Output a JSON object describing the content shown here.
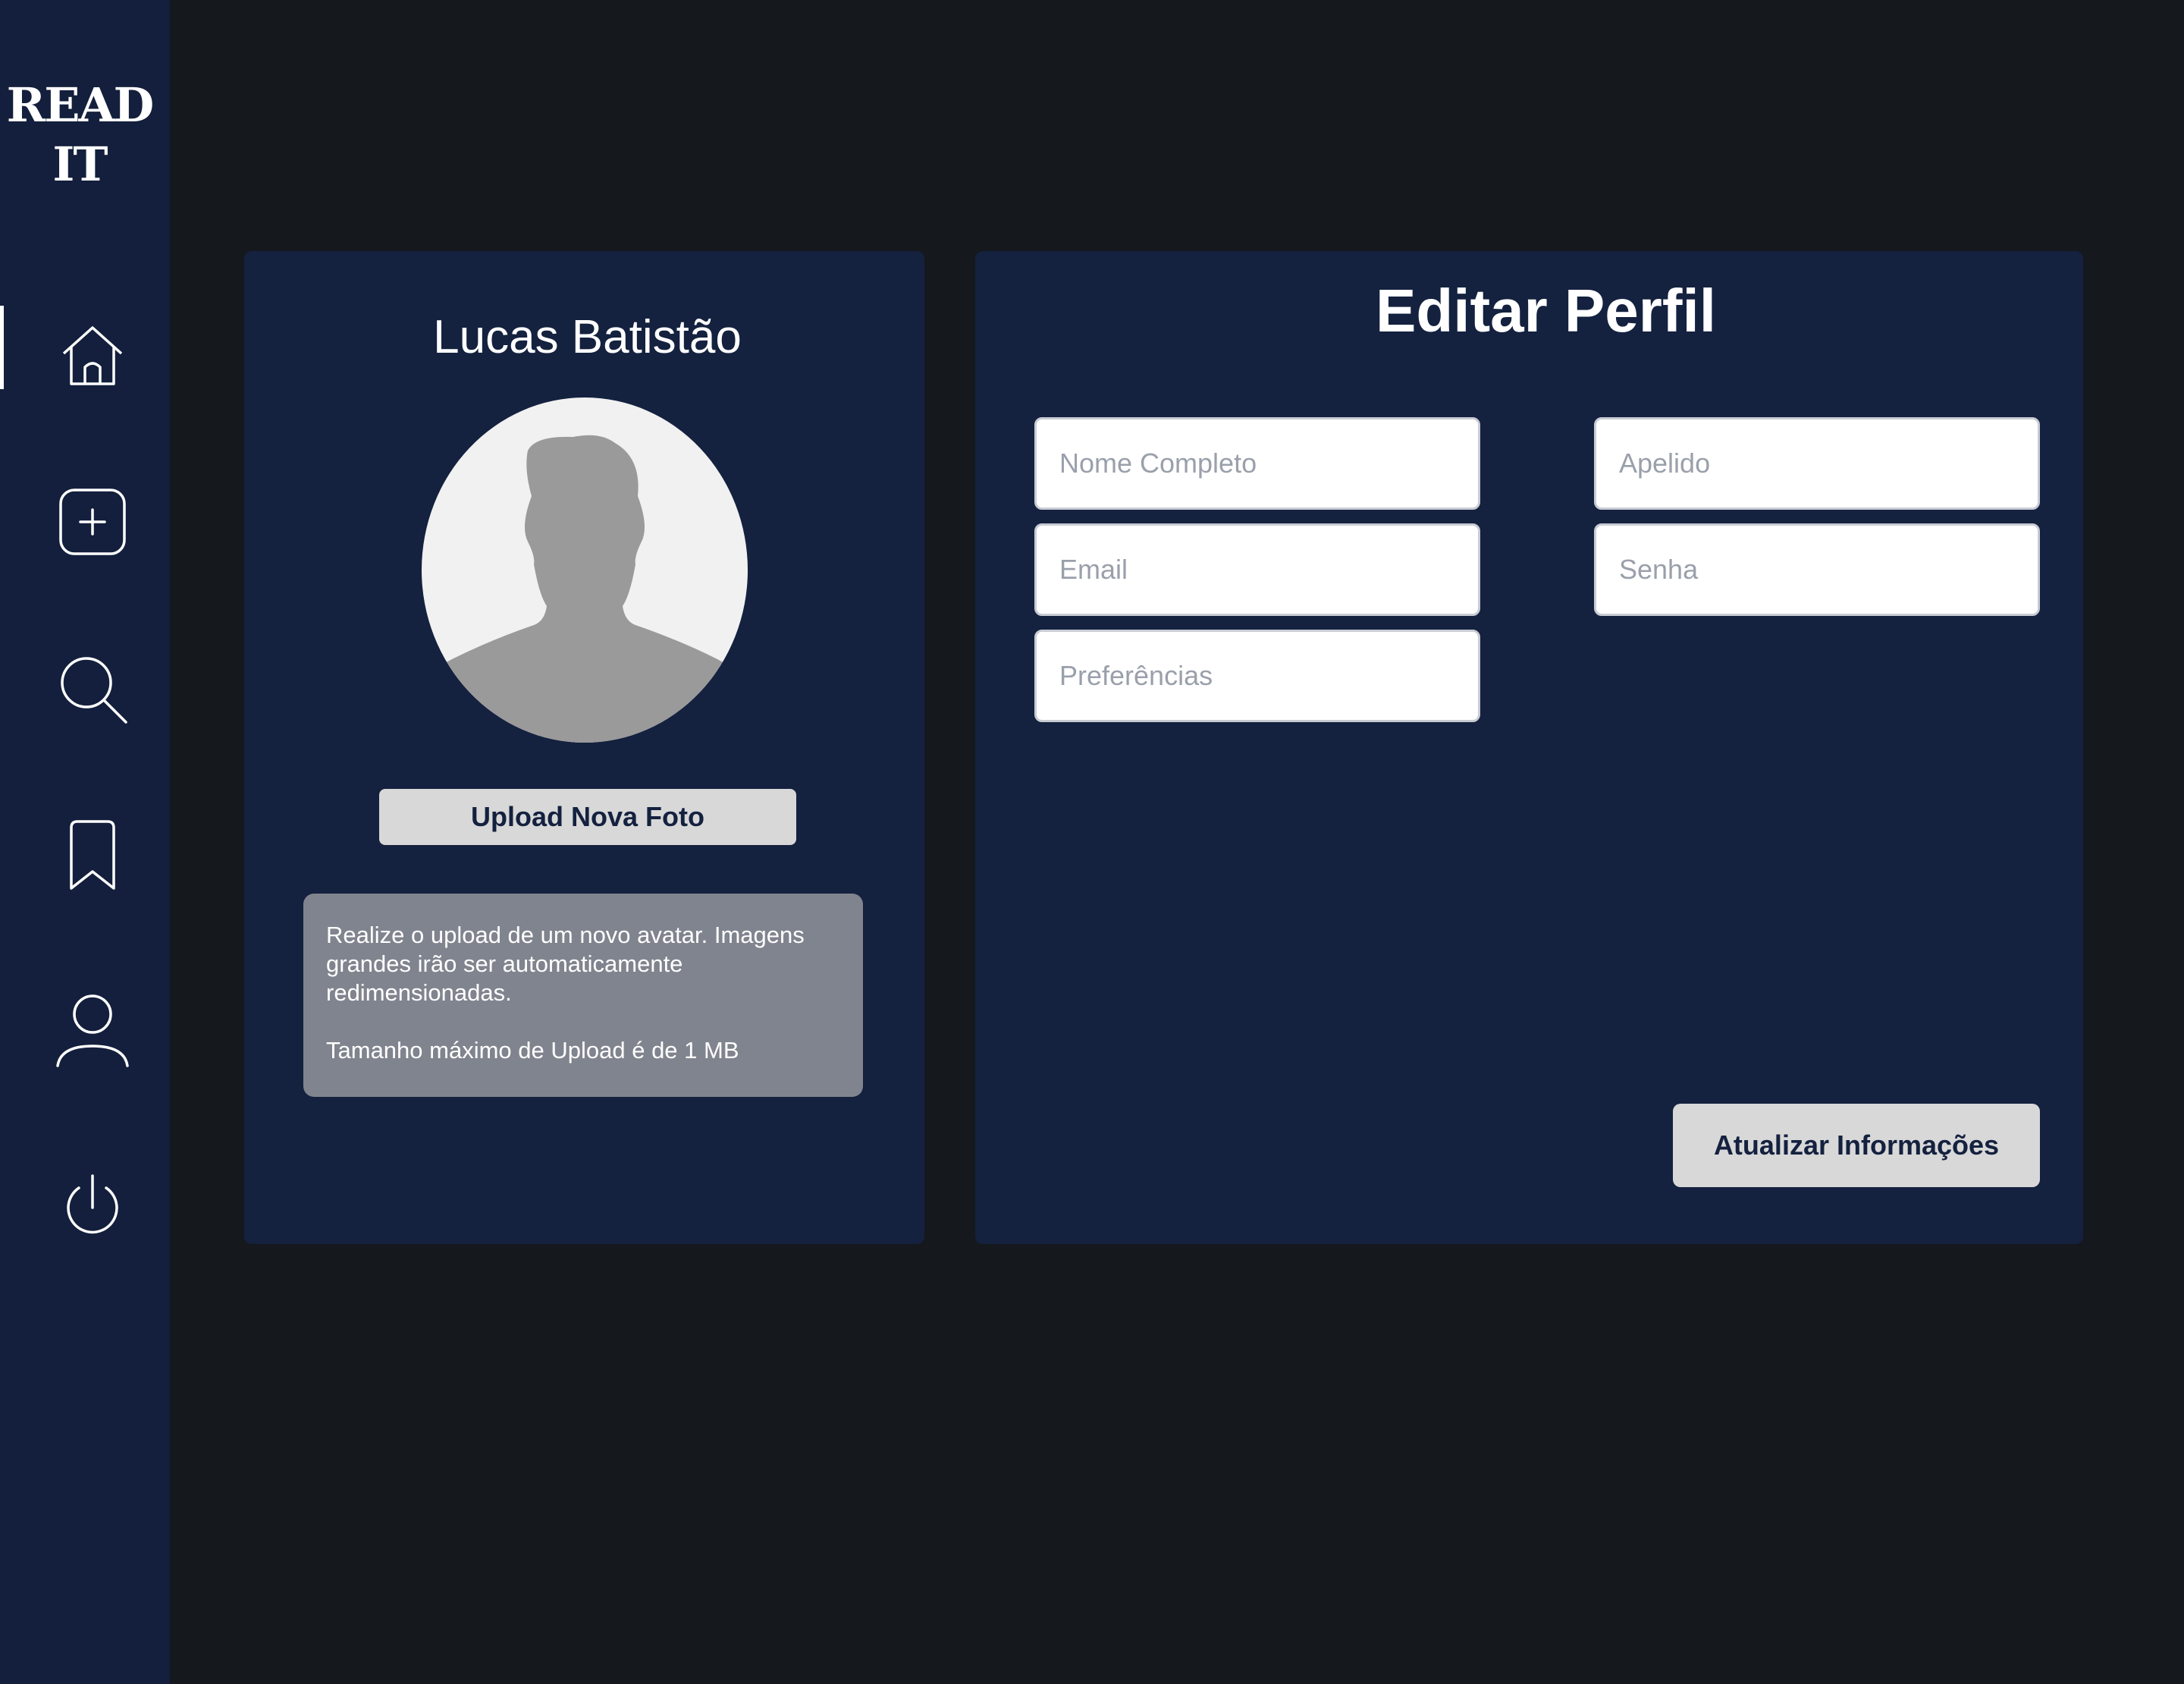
{
  "sidebar": {
    "logo_line1": "READ",
    "logo_line2": "IT",
    "nav": [
      {
        "icon": "home-icon",
        "active": true
      },
      {
        "icon": "add-icon"
      },
      {
        "icon": "search-icon"
      },
      {
        "icon": "bookmark-icon"
      },
      {
        "icon": "user-icon"
      },
      {
        "icon": "power-icon"
      }
    ]
  },
  "profile": {
    "name": "Lucas Batistão",
    "upload_label": "Upload Nova Foto",
    "info_line1": "Realize o upload de um novo avatar. Imagens grandes irão ser automaticamente redimensionadas.",
    "info_line2": "Tamanho máximo de Upload é de 1 MB"
  },
  "form": {
    "title": "Editar Perfil",
    "full_name_placeholder": "Nome Completo",
    "nickname_placeholder": "Apelido",
    "email_placeholder": "Email",
    "password_placeholder": "Senha",
    "preferences_placeholder": "Preferências",
    "submit_label": "Atualizar Informações"
  },
  "colors": {
    "background": "#15181d",
    "sidebar": "#131f3c",
    "card": "#14213f",
    "button": "#d8d8d8",
    "info_box": "#80848e"
  }
}
